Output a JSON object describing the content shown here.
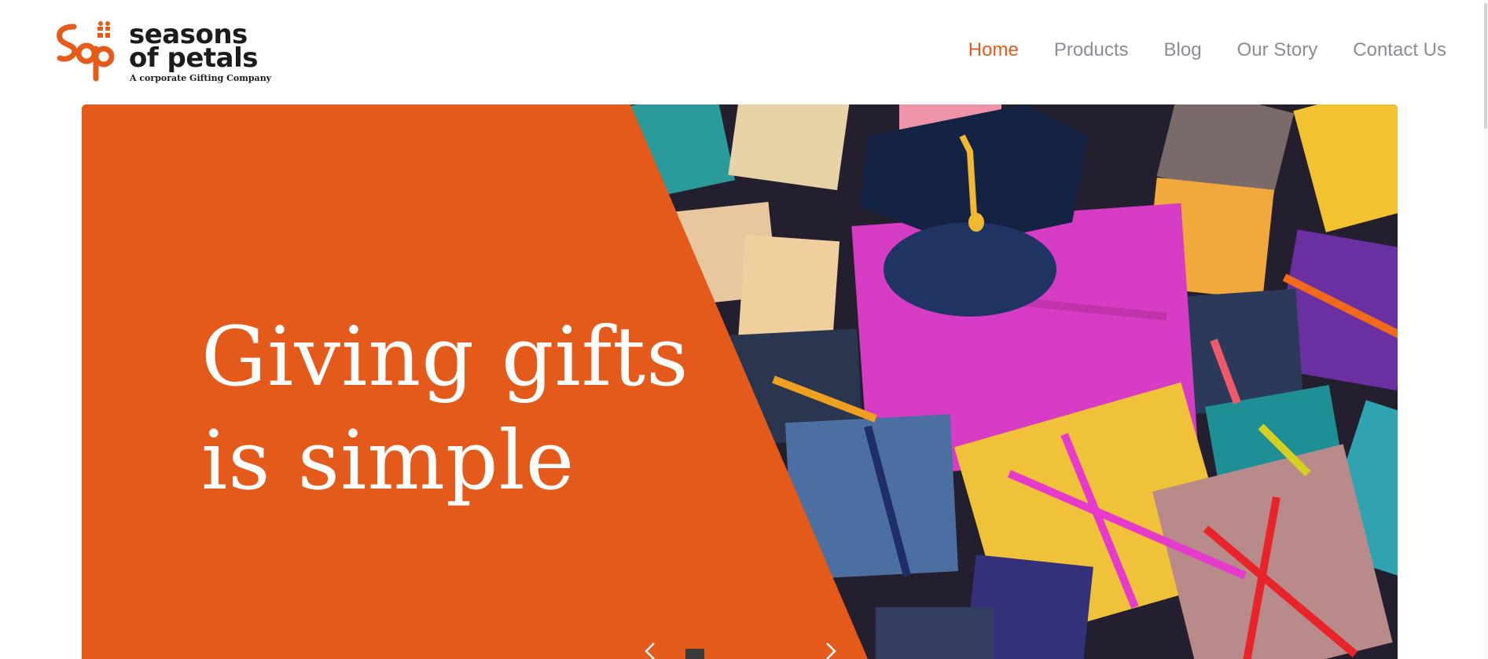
{
  "logo": {
    "line1": "seasons",
    "line2": "of petals",
    "tagline": "A corporate Gifting Company",
    "brand_color": "#e55b1a"
  },
  "nav": {
    "items": [
      {
        "label": "Home",
        "active": true
      },
      {
        "label": "Products",
        "active": false
      },
      {
        "label": "Blog",
        "active": false
      },
      {
        "label": "Our Story",
        "active": false
      },
      {
        "label": "Contact Us",
        "active": false
      }
    ]
  },
  "hero": {
    "title_line1": "Giving gifts",
    "title_line2": "is simple",
    "panel_color": "#e35a1b",
    "image_subject": "gift-boxes-and-graduation-cap"
  },
  "slider": {
    "prev_icon": "chevron-left-icon",
    "next_icon": "chevron-right-icon"
  }
}
